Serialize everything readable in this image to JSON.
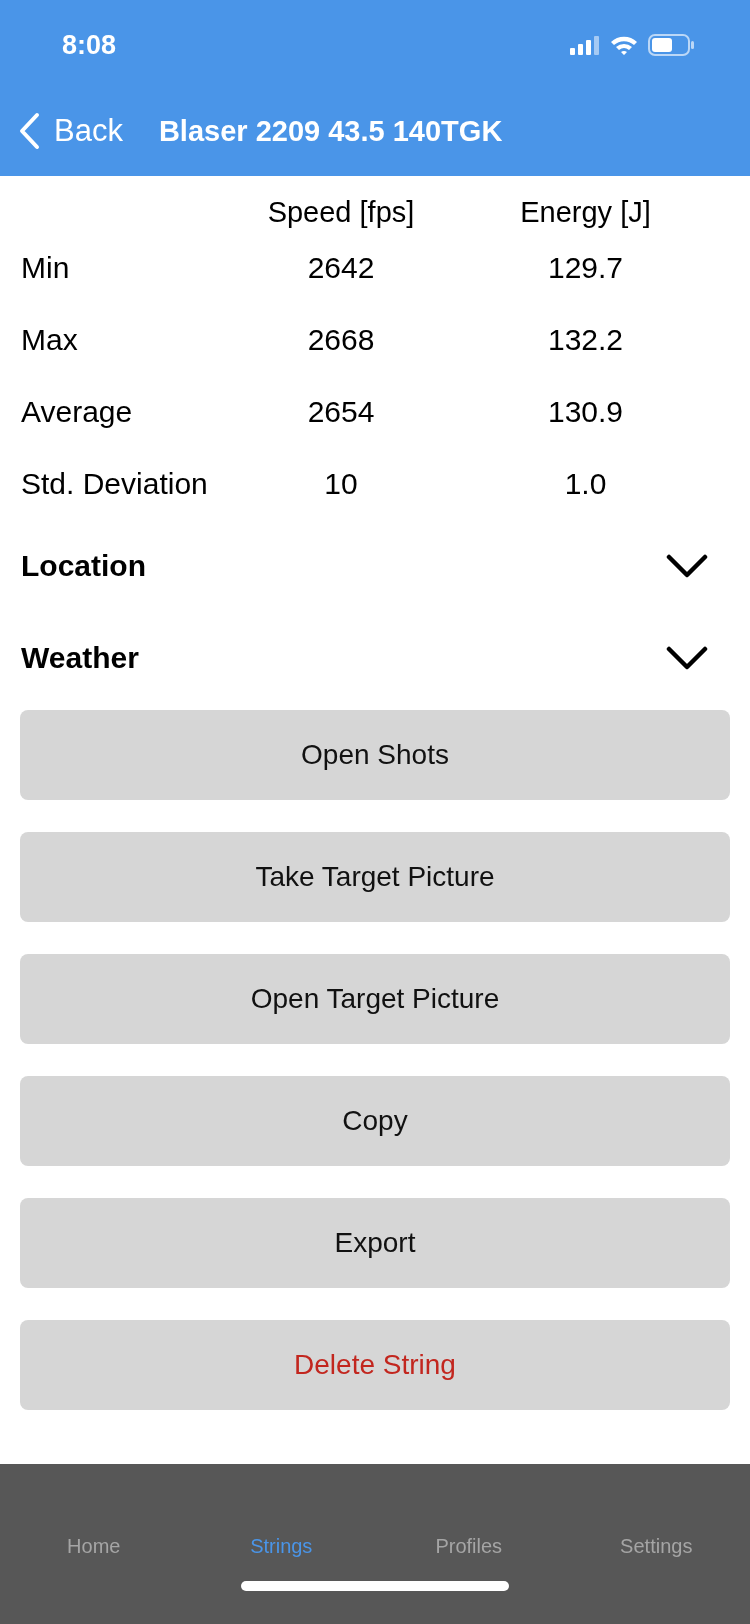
{
  "status_bar": {
    "time": "8:08"
  },
  "nav_bar": {
    "back": "Back",
    "title": "Blaser 2209 43.5 140TGK"
  },
  "stats_table": {
    "columns": [
      "Speed [fps]",
      "Energy [J]"
    ],
    "rows": [
      {
        "label": "Min",
        "speed": "2642",
        "energy": "129.7"
      },
      {
        "label": "Max",
        "speed": "2668",
        "energy": "132.2"
      },
      {
        "label": "Average",
        "speed": "2654",
        "energy": "130.9"
      },
      {
        "label": "Std. Deviation",
        "speed": "10",
        "energy": "1.0"
      }
    ]
  },
  "sections": [
    {
      "title": "Location",
      "expanded": false
    },
    {
      "title": "Weather",
      "expanded": false
    }
  ],
  "buttons": [
    {
      "label": "Open Shots",
      "kind": "normal"
    },
    {
      "label": "Take Target Picture",
      "kind": "normal"
    },
    {
      "label": "Open Target Picture",
      "kind": "normal"
    },
    {
      "label": "Copy",
      "kind": "normal"
    },
    {
      "label": "Export",
      "kind": "normal"
    },
    {
      "label": "Delete String",
      "kind": "destructive"
    }
  ],
  "tab_bar": [
    {
      "label": "Home",
      "selected": false
    },
    {
      "label": "Strings",
      "selected": true
    },
    {
      "label": "Profiles",
      "selected": false
    },
    {
      "label": "Settings",
      "selected": false
    }
  ]
}
